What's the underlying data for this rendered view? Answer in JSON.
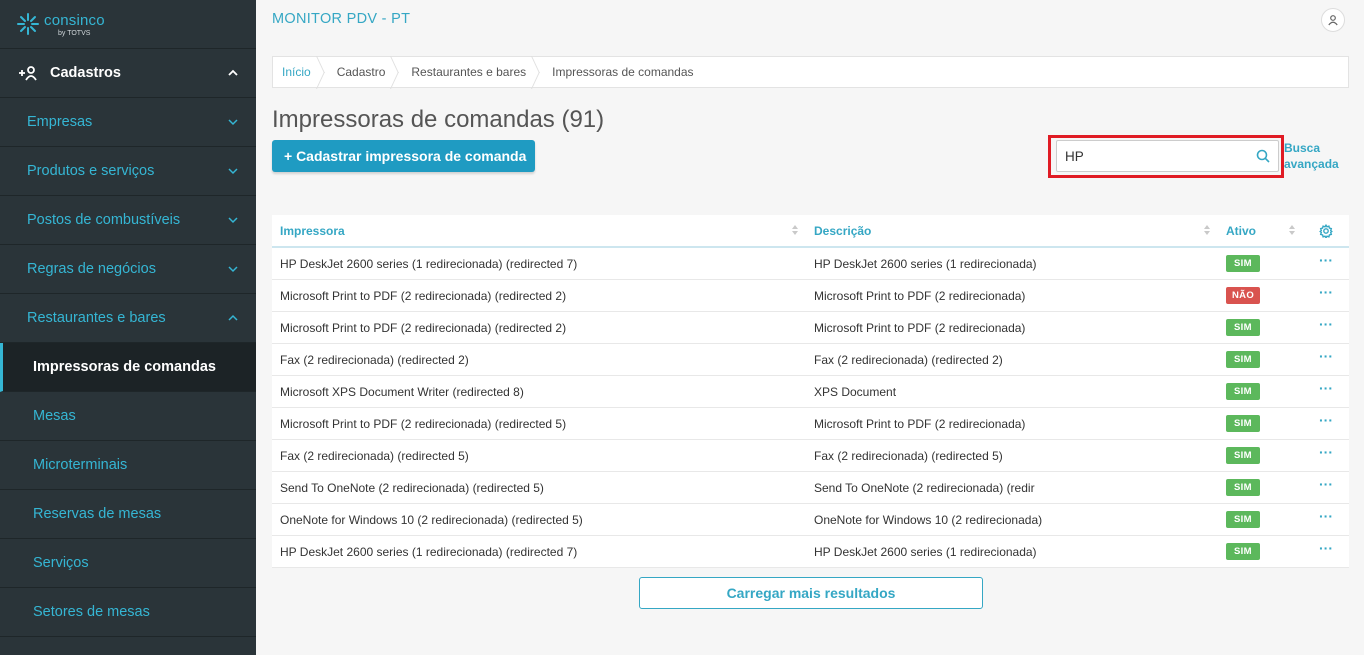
{
  "brand": {
    "name": "consinco",
    "sub": "by TOTVS"
  },
  "sidebar": {
    "group": "Cadastros",
    "items": [
      {
        "label": "Empresas"
      },
      {
        "label": "Produtos e serviços"
      },
      {
        "label": "Postos de combustíveis"
      },
      {
        "label": "Regras de negócios"
      },
      {
        "label": "Restaurantes e bares"
      }
    ],
    "subitems": [
      {
        "label": "Impressoras de comandas"
      },
      {
        "label": "Mesas"
      },
      {
        "label": "Microterminais"
      },
      {
        "label": "Reservas de mesas"
      },
      {
        "label": "Serviços"
      },
      {
        "label": "Setores de mesas"
      }
    ]
  },
  "header": {
    "title": "MONITOR PDV - PT"
  },
  "breadcrumb": [
    "Início",
    "Cadastro",
    "Restaurantes e bares",
    "Impressoras de comandas"
  ],
  "page": {
    "title": "Impressoras de comandas (91)",
    "add_label": "+ Cadastrar impressora de comanda",
    "search_value": "HP",
    "adv_search_1": "Busca",
    "adv_search_2": "avançada",
    "load_more": "Carregar mais resultados"
  },
  "table": {
    "headers": [
      "Impressora",
      "Descrição",
      "Ativo"
    ],
    "rows": [
      {
        "printer": "HP DeskJet 2600 series (1 redirecionada) (redirected 7)",
        "desc": "HP DeskJet 2600 series (1 redirecionada)",
        "active": "SIM"
      },
      {
        "printer": "Microsoft Print to PDF (2 redirecionada) (redirected 2)",
        "desc": "Microsoft Print to PDF (2 redirecionada)",
        "active": "NÃO"
      },
      {
        "printer": "Microsoft Print to PDF (2 redirecionada) (redirected 2)",
        "desc": "Microsoft Print to PDF (2 redirecionada)",
        "active": "SIM"
      },
      {
        "printer": "Fax (2 redirecionada) (redirected 2)",
        "desc": "Fax (2 redirecionada) (redirected 2)",
        "active": "SIM"
      },
      {
        "printer": "Microsoft XPS Document Writer (redirected 8)",
        "desc": "XPS Document",
        "active": "SIM"
      },
      {
        "printer": "Microsoft Print to PDF (2 redirecionada) (redirected 5)",
        "desc": "Microsoft Print to PDF (2 redirecionada)",
        "active": "SIM"
      },
      {
        "printer": "Fax (2 redirecionada) (redirected 5)",
        "desc": "Fax (2 redirecionada) (redirected 5)",
        "active": "SIM"
      },
      {
        "printer": "Send To OneNote (2 redirecionada) (redirected 5)",
        "desc": "Send To OneNote (2 redirecionada) (redir",
        "active": "SIM"
      },
      {
        "printer": "OneNote for Windows 10 (2 redirecionada) (redirected 5)",
        "desc": "OneNote for Windows 10 (2 redirecionada)",
        "active": "SIM"
      },
      {
        "printer": "HP DeskJet 2600 series (1 redirecionada) (redirected 7)",
        "desc": "HP DeskJet 2600 series (1 redirecionada)",
        "active": "SIM"
      }
    ]
  },
  "colors": {
    "accent": "#35a7c4",
    "primary_button": "#1f9bc2",
    "sidebar_bg": "#2a3439",
    "sim": "#5cb85c",
    "nao": "#d9534f",
    "highlight": "#e01b24"
  }
}
